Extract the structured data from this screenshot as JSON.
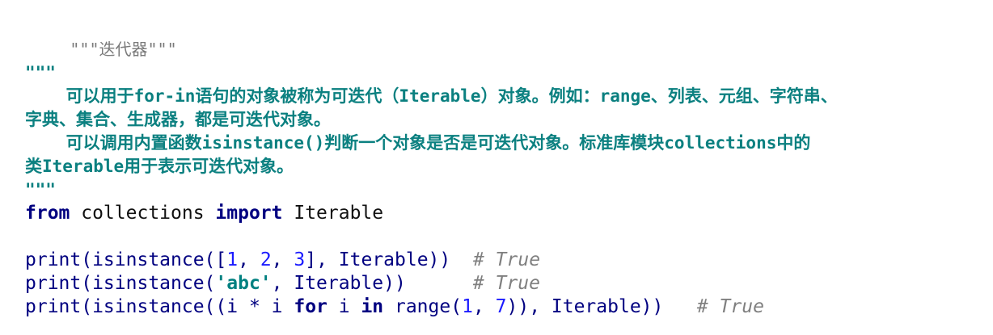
{
  "code": {
    "title_docstring": "\"\"\"迭代器\"\"\"",
    "doc_open": "\"\"\"",
    "doc_line1": "    可以用于for-in语句的对象被称为可迭代（Iterable）对象。例如：range、列表、元组、字符串、",
    "doc_line2": "字典、集合、生成器，都是可迭代对象。",
    "doc_line3": "    可以调用内置函数isinstance()判断一个对象是否是可迭代对象。标准库模块collections中的",
    "doc_line4": "类Iterable用于表示可迭代对象。",
    "doc_close": "\"\"\"",
    "import_line": {
      "from": "from",
      "module": " collections ",
      "import": "import",
      "name": " Iterable"
    },
    "print1": {
      "fn": "print(isinstance([",
      "n1": "1",
      "sep1": ", ",
      "n2": "2",
      "sep2": ", ",
      "n3": "3",
      "rest": "], Iterable))  ",
      "comment": "# True"
    },
    "print2": {
      "fn": "print(isinstance(",
      "str": "'abc'",
      "rest": ", Iterable))      ",
      "comment": "# True"
    },
    "print3": {
      "fn": "print(isinstance((i * i ",
      "kw_for": "for",
      "mid": " i ",
      "kw_in": "in",
      "range": " range(",
      "n1": "1",
      "sep": ", ",
      "n2": "7",
      "rest": ")), Iterable))   ",
      "comment": "# True"
    }
  }
}
